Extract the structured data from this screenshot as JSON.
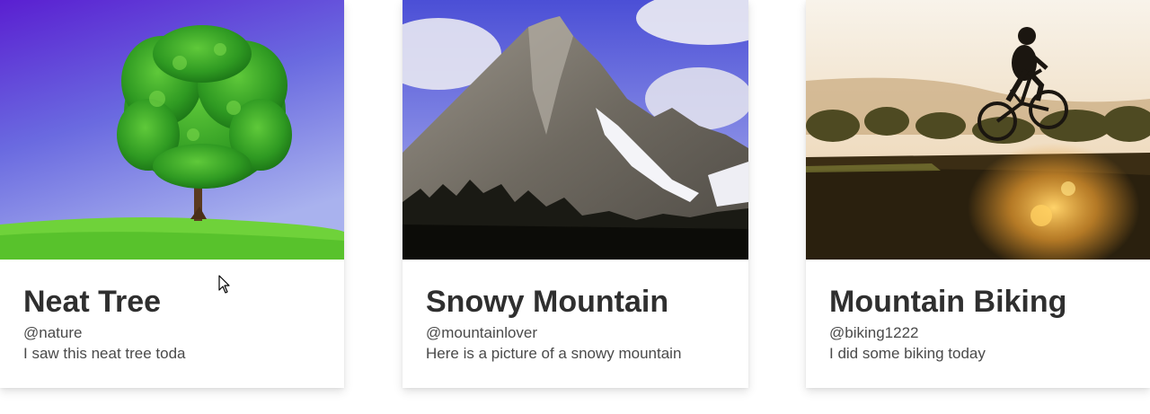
{
  "cards": [
    {
      "title": "Neat Tree",
      "handle": "@nature",
      "description": "I saw this neat tree toda",
      "image_icon": "tree-photo"
    },
    {
      "title": "Snowy Mountain",
      "handle": "@mountainlover",
      "description": "Here is a picture of a snowy mountain",
      "image_icon": "mountain-photo"
    },
    {
      "title": "Mountain Biking",
      "handle": "@biking1222",
      "description": "I did some biking today",
      "image_icon": "biking-photo"
    }
  ],
  "colors": {
    "title": "#2f2f2f",
    "text": "#4a4a4a",
    "card_bg": "#ffffff"
  }
}
